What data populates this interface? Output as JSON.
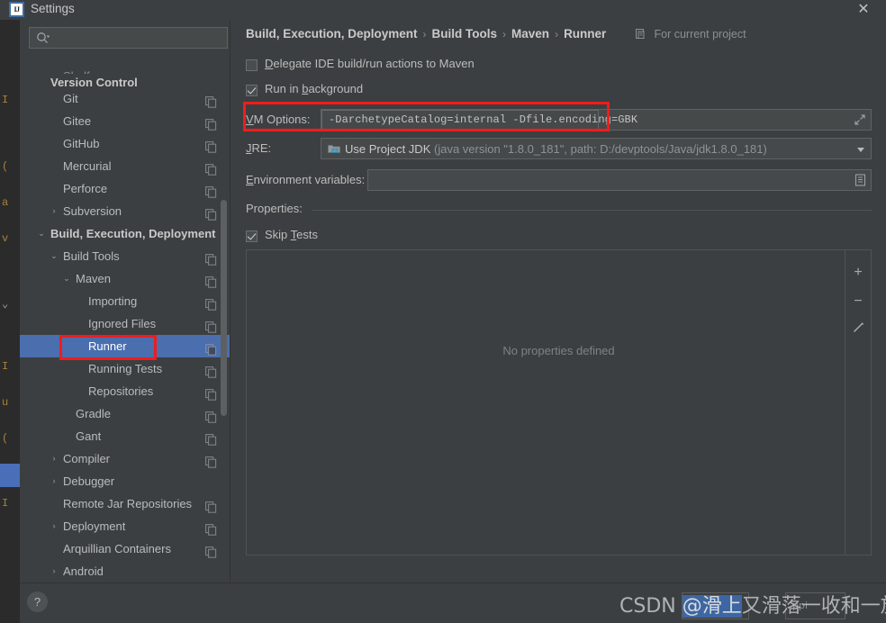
{
  "window": {
    "title": "Settings",
    "logo_text": "IJ",
    "close_label": "✕"
  },
  "search": {
    "value": "",
    "placeholder": ""
  },
  "sidebar": {
    "sticky_header": "Version Control",
    "items": [
      {
        "label": "Shelf",
        "indent": 48,
        "arrow": "",
        "copy": true,
        "bold": false,
        "selected": false,
        "dim": true
      },
      {
        "label": "Git",
        "indent": 48,
        "arrow": "",
        "copy": true,
        "bold": false,
        "selected": false,
        "dim": false
      },
      {
        "label": "Gitee",
        "indent": 48,
        "arrow": "",
        "copy": true,
        "bold": false,
        "selected": false,
        "dim": false
      },
      {
        "label": "GitHub",
        "indent": 48,
        "arrow": "",
        "copy": true,
        "bold": false,
        "selected": false,
        "dim": false
      },
      {
        "label": "Mercurial",
        "indent": 48,
        "arrow": "",
        "copy": true,
        "bold": false,
        "selected": false,
        "dim": false
      },
      {
        "label": "Perforce",
        "indent": 48,
        "arrow": "",
        "copy": true,
        "bold": false,
        "selected": false,
        "dim": false
      },
      {
        "label": "Subversion",
        "indent": 48,
        "arrow": "›",
        "copy": true,
        "bold": false,
        "selected": false,
        "dim": false
      },
      {
        "label": "Build, Execution, Deployment",
        "indent": 34,
        "arrow": "⌄",
        "copy": false,
        "bold": true,
        "selected": false,
        "dim": false
      },
      {
        "label": "Build Tools",
        "indent": 48,
        "arrow": "⌄",
        "copy": true,
        "bold": false,
        "selected": false,
        "dim": false
      },
      {
        "label": "Maven",
        "indent": 62,
        "arrow": "⌄",
        "copy": true,
        "bold": false,
        "selected": false,
        "dim": false
      },
      {
        "label": "Importing",
        "indent": 76,
        "arrow": "",
        "copy": true,
        "bold": false,
        "selected": false,
        "dim": false
      },
      {
        "label": "Ignored Files",
        "indent": 76,
        "arrow": "",
        "copy": true,
        "bold": false,
        "selected": false,
        "dim": false
      },
      {
        "label": "Runner",
        "indent": 76,
        "arrow": "",
        "copy": true,
        "bold": false,
        "selected": true,
        "dim": false
      },
      {
        "label": "Running Tests",
        "indent": 76,
        "arrow": "",
        "copy": true,
        "bold": false,
        "selected": false,
        "dim": false
      },
      {
        "label": "Repositories",
        "indent": 76,
        "arrow": "",
        "copy": true,
        "bold": false,
        "selected": false,
        "dim": false
      },
      {
        "label": "Gradle",
        "indent": 62,
        "arrow": "",
        "copy": true,
        "bold": false,
        "selected": false,
        "dim": false
      },
      {
        "label": "Gant",
        "indent": 62,
        "arrow": "",
        "copy": true,
        "bold": false,
        "selected": false,
        "dim": false
      },
      {
        "label": "Compiler",
        "indent": 48,
        "arrow": "›",
        "copy": true,
        "bold": false,
        "selected": false,
        "dim": false
      },
      {
        "label": "Debugger",
        "indent": 48,
        "arrow": "›",
        "copy": false,
        "bold": false,
        "selected": false,
        "dim": false
      },
      {
        "label": "Remote Jar Repositories",
        "indent": 48,
        "arrow": "",
        "copy": true,
        "bold": false,
        "selected": false,
        "dim": false
      },
      {
        "label": "Deployment",
        "indent": 48,
        "arrow": "›",
        "copy": true,
        "bold": false,
        "selected": false,
        "dim": false
      },
      {
        "label": "Arquillian Containers",
        "indent": 48,
        "arrow": "",
        "copy": true,
        "bold": false,
        "selected": false,
        "dim": false
      },
      {
        "label": "Android",
        "indent": 48,
        "arrow": "›",
        "copy": false,
        "bold": false,
        "selected": false,
        "dim": false
      }
    ]
  },
  "main": {
    "breadcrumb": [
      "Build, Execution, Deployment",
      "Build Tools",
      "Maven",
      "Runner"
    ],
    "breadcrumb_separator": "›",
    "scope_badge": "For current project",
    "delegate_checkbox": {
      "label_before": "",
      "mnemonic": "D",
      "label_after": "elegate IDE build/run actions to Maven",
      "checked": false
    },
    "run_background_checkbox": {
      "label_before": "Run in ",
      "mnemonic": "b",
      "label_after": "ackground",
      "checked": true
    },
    "vm_options": {
      "label_mnemonic": "V",
      "label_rest": "M Options:",
      "value": "-DarchetypeCatalog=internal -Dfile.encoding=GBK"
    },
    "jre": {
      "label_mnemonic": "J",
      "label_rest": "RE:",
      "value": "Use Project JDK",
      "detail": "(java version \"1.8.0_181\", path: D:/devptools/Java/jdk1.8.0_181)"
    },
    "env_variables": {
      "label_mnemonic": "E",
      "label_rest": "nvironment variables:",
      "value": ""
    },
    "properties_section_label": "Properties:",
    "skip_tests_checkbox": {
      "label_before": "Skip ",
      "mnemonic": "T",
      "label_after": "ests",
      "checked": true
    },
    "properties_table": {
      "empty_message": "No properties defined",
      "toolbar": {
        "add": "+",
        "remove": "−",
        "edit": "✎"
      }
    }
  },
  "footer": {
    "help_label": "?"
  },
  "watermark": {
    "prefix": "CSDN ",
    "highlight": "@滑上",
    "rest": "又滑落一收和一放",
    "ghost_left": "el",
    "ghost_right": "ppi"
  },
  "colors": {
    "background": "#3c3f41",
    "selection": "#4b6eaf",
    "annotation": "#f01c1c",
    "field_bg": "#45494a",
    "text": "#bbbbbb"
  }
}
